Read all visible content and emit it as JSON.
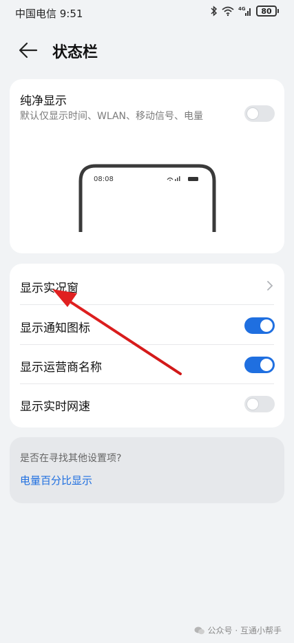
{
  "status_bar": {
    "carrier_time": "中国电信 9:51",
    "battery": "80",
    "icons": [
      "bluetooth-icon",
      "wifi-icon",
      "signal-icon",
      "battery-icon"
    ]
  },
  "header": {
    "title": "状态栏",
    "back_icon": "back-arrow-icon"
  },
  "pure_display": {
    "title": "纯净显示",
    "description": "默认仅显示时间、WLAN、移动信号、电量",
    "enabled": false,
    "preview_time": "08:08"
  },
  "settings": [
    {
      "label": "显示实况窗",
      "control": "chevron"
    },
    {
      "label": "显示通知图标",
      "control": "toggle",
      "enabled": true
    },
    {
      "label": "显示运营商名称",
      "control": "toggle",
      "enabled": true
    },
    {
      "label": "显示实时网速",
      "control": "toggle",
      "enabled": false
    }
  ],
  "suggestion": {
    "question": "是否在寻找其他设置项?",
    "link": "电量百分比显示"
  },
  "watermark": "公众号 · 互通小帮手",
  "colors": {
    "accent": "#1f6fe0",
    "background": "#f1f3f5",
    "annotation": "#e02020"
  }
}
